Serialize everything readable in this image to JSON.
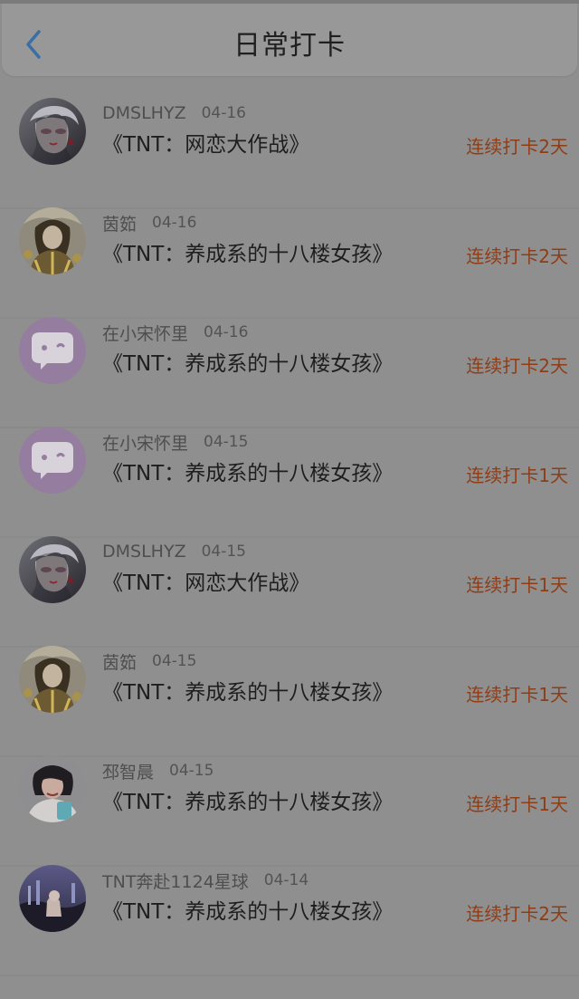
{
  "header": {
    "title": "日常打卡",
    "back_icon": "chevron-left-icon",
    "back_color": "#3a6fa6"
  },
  "list": [
    {
      "username": "DMSLHYZ",
      "date": "04-16",
      "book": "《TNT：网恋大作战》",
      "streak": "连续打卡2天",
      "avatar": "anime-girl-white-hair"
    },
    {
      "username": "茵筎",
      "date": "04-16",
      "book": "《TNT：养成系的十八楼女孩》",
      "streak": "连续打卡2天",
      "avatar": "gold-dress-portrait"
    },
    {
      "username": "在小宋怀里",
      "date": "04-16",
      "book": "《TNT：养成系的十八楼女孩》",
      "streak": "连续打卡2天",
      "avatar": "chat-bubble-icon"
    },
    {
      "username": "在小宋怀里",
      "date": "04-15",
      "book": "《TNT：养成系的十八楼女孩》",
      "streak": "连续打卡1天",
      "avatar": "chat-bubble-icon"
    },
    {
      "username": "DMSLHYZ",
      "date": "04-15",
      "book": "《TNT：网恋大作战》",
      "streak": "连续打卡1天",
      "avatar": "anime-girl-white-hair"
    },
    {
      "username": "茵筎",
      "date": "04-15",
      "book": "《TNT：养成系的十八楼女孩》",
      "streak": "连续打卡1天",
      "avatar": "gold-dress-portrait"
    },
    {
      "username": "邳智晨",
      "date": "04-15",
      "book": "《TNT：养成系的十八楼女孩》",
      "streak": "连续打卡1天",
      "avatar": "photo-girl-phone"
    },
    {
      "username": "TNT奔赴1124星球",
      "date": "04-14",
      "book": "《TNT：养成系的十八楼女孩》",
      "streak": "连续打卡2天",
      "avatar": "night-sky-photo"
    }
  ],
  "colors": {
    "background": "#8f8f8f",
    "title": "#202020",
    "username": "#4e4e4e",
    "book_title": "#1e1e1e",
    "streak": "#8f3d16",
    "avatar_chat": "#b99bd3"
  }
}
